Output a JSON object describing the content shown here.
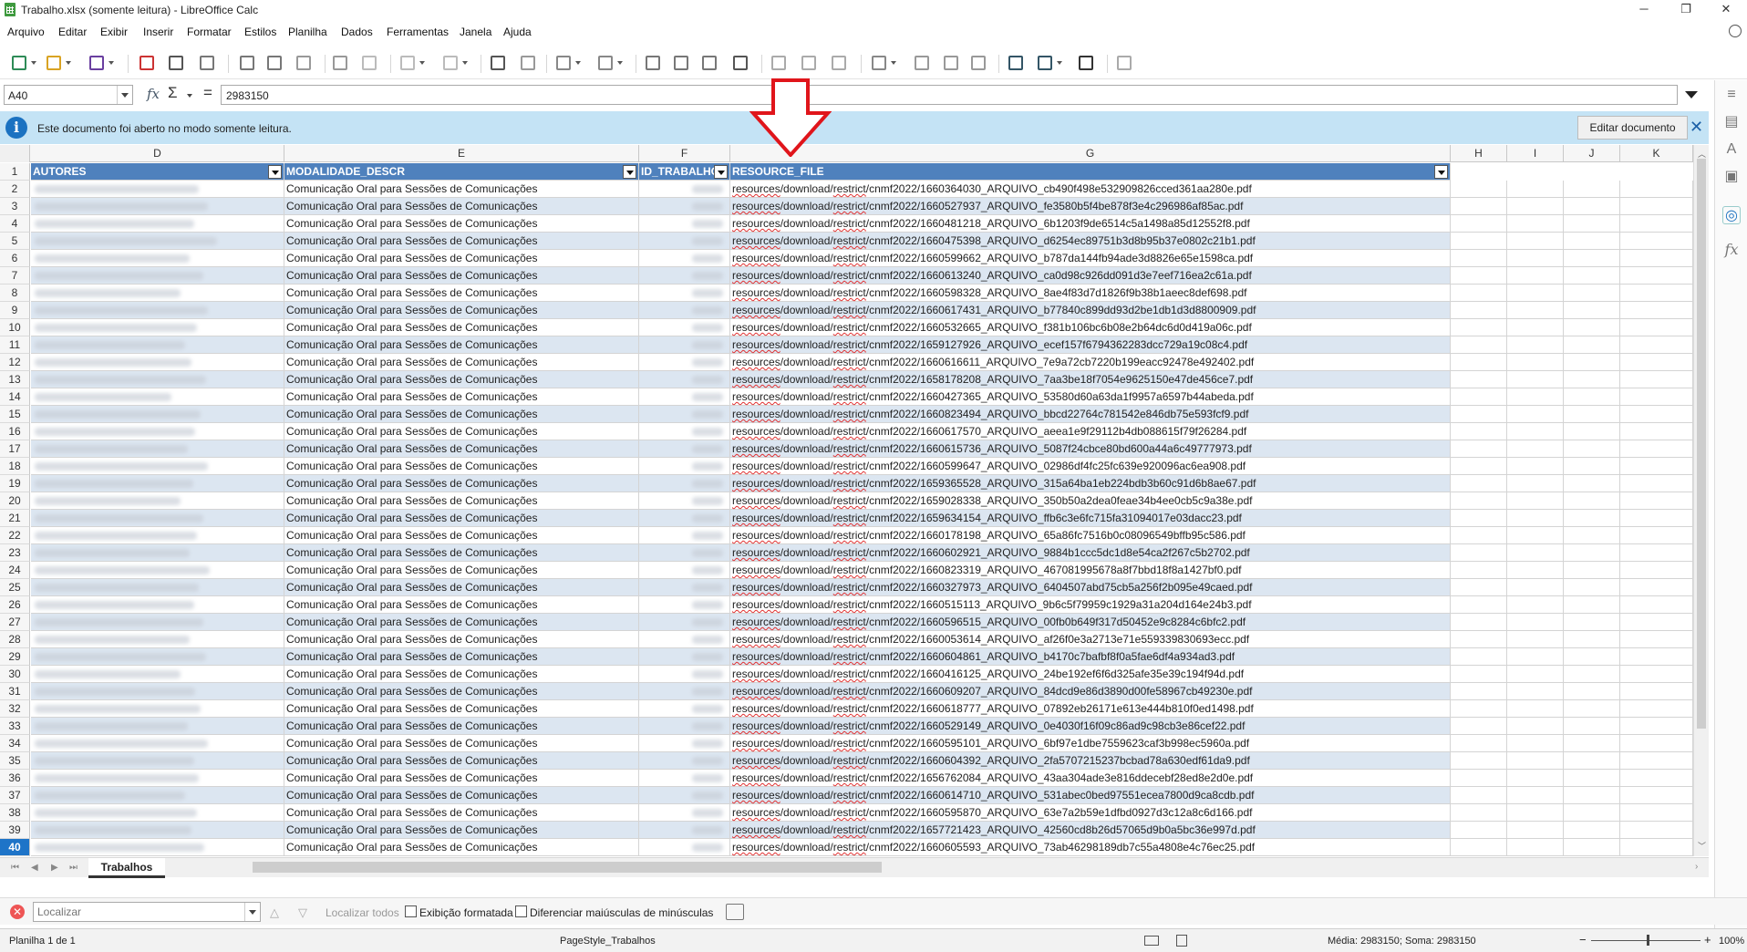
{
  "window": {
    "title": "Trabalho.xlsx (somente leitura) - LibreOffice Calc",
    "minimize": "─",
    "restore": "❐",
    "close": "✕"
  },
  "menu": [
    "Arquivo",
    "Editar",
    "Exibir",
    "Inserir",
    "Formatar",
    "Estilos",
    "Planilha",
    "Dados",
    "Ferramentas",
    "Janela",
    "Ajuda"
  ],
  "toolbar_icons": [
    "new-icon",
    "open-icon",
    "save-icon",
    "export-pdf-icon",
    "print-icon",
    "print-preview-icon",
    "cut-icon",
    "copy-icon",
    "paste-icon",
    "clone-format-icon",
    "clear-format-icon",
    "undo-icon",
    "redo-icon",
    "find-replace-icon",
    "spelling-icon",
    "row-icon",
    "column-icon",
    "sort-icon",
    "sort-ascending-icon",
    "sort-descending-icon",
    "autofilter-icon",
    "image-icon",
    "chart-icon",
    "pivot-table-icon",
    "special-character-icon",
    "hyperlink-icon",
    "comment-icon",
    "header-footer-icon",
    "define-print-area-icon",
    "freeze-rows-icon",
    "split-window-icon",
    "show-draw-functions-icon"
  ],
  "formula_bar": {
    "cell_ref": "A40",
    "fx": "fx",
    "sigma": "Σ",
    "equals": "=",
    "value": "2983150"
  },
  "infobar": {
    "message": "Este documento foi aberto no modo somente leitura.",
    "button": "Editar documento",
    "close": "✕"
  },
  "columns": [
    {
      "letter": "D"
    },
    {
      "letter": "E"
    },
    {
      "letter": "F"
    },
    {
      "letter": "G"
    },
    {
      "letter": "H"
    },
    {
      "letter": "I"
    },
    {
      "letter": "J"
    },
    {
      "letter": "K"
    }
  ],
  "headers": {
    "autores": "AUTORES",
    "modalidade": "MODALIDADE_DESCR",
    "id_trabalho": "ID_TRABALHO",
    "resource_file": "RESOURCE_FILE"
  },
  "modalidade_value": "Comunicação Oral para Sessões de Comunicações",
  "resource_prefix": "resources/download/restrict/cnmf2022/",
  "files": [
    "1660364030_ARQUIVO_cb490f498e532909826cced361aa280e.pdf",
    "1660527937_ARQUIVO_fe3580b5f4be878f3e4c296986af85ac.pdf",
    "1660481218_ARQUIVO_6b1203f9de6514c5a1498a85d12552f8.pdf",
    "1660475398_ARQUIVO_d6254ec89751b3d8b95b37e0802c21b1.pdf",
    "1660599662_ARQUIVO_b787da144fb94ade3d8826e65e1598ca.pdf",
    "1660613240_ARQUIVO_ca0d98c926dd091d3e7eef716ea2c61a.pdf",
    "1660598328_ARQUIVO_8ae4f83d7d1826f9b38b1aeec8def698.pdf",
    "1660617431_ARQUIVO_b77840c899dd93d2be1db1d3d8800909.pdf",
    "1660532665_ARQUIVO_f381b106bc6b08e2b64dc6d0d419a06c.pdf",
    "1659127926_ARQUIVO_ecef157f6794362283dcc729a19c08c4.pdf",
    "1660616611_ARQUIVO_7e9a72cb7220b199eacc92478e492402.pdf",
    "1658178208_ARQUIVO_7aa3be18f7054e9625150e47de456ce7.pdf",
    "1660427365_ARQUIVO_53580d60a63da1f9957a6597b44abeda.pdf",
    "1660823494_ARQUIVO_bbcd22764c781542e846db75e593fcf9.pdf",
    "1660617570_ARQUIVO_aeea1e9f29112b4db088615f79f26284.pdf",
    "1660615736_ARQUIVO_5087f24cbce80bd600a44a6c49777973.pdf",
    "1660599647_ARQUIVO_02986df4fc25fc639e920096ac6ea908.pdf",
    "1659365528_ARQUIVO_315a64ba1eb224bdb3b60c91d6b8ae67.pdf",
    "1659028338_ARQUIVO_350b50a2dea0feae34b4ee0cb5c9a38e.pdf",
    "1659634154_ARQUIVO_ffb6c3e6fc715fa31094017e03dacc23.pdf",
    "1660178198_ARQUIVO_65a86fc7516b0c08096549bffb95c586.pdf",
    "1660602921_ARQUIVO_9884b1ccc5dc1d8e54ca2f267c5b2702.pdf",
    "1660823319_ARQUIVO_467081995678a8f7bbd18f8a1427bf0.pdf",
    "1660327973_ARQUIVO_6404507abd75cb5a256f2b095e49caed.pdf",
    "1660515113_ARQUIVO_9b6c5f79959c1929a31a204d164e24b3.pdf",
    "1660596515_ARQUIVO_00fb0b649f317d50452e9c8284c6bfc2.pdf",
    "1660053614_ARQUIVO_af26f0e3a2713e71e559339830693ecc.pdf",
    "1660604861_ARQUIVO_b4170c7bafbf8f0a5fae6df4a934ad3.pdf",
    "1660416125_ARQUIVO_24be192ef6f6d325afe35e39c194f94d.pdf",
    "1660609207_ARQUIVO_84dcd9e86d3890d00fe58967cb49230e.pdf",
    "1660618777_ARQUIVO_07892eb26171e613e444b810f0ed1498.pdf",
    "1660529149_ARQUIVO_0e4030f16f09c86ad9c98cb3e86cef22.pdf",
    "1660595101_ARQUIVO_6bf97e1dbe7559623caf3b998ec5960a.pdf",
    "1660604392_ARQUIVO_2fa5707215237bcbad78a630edf61da9.pdf",
    "1656762084_ARQUIVO_43aa304ade3e816ddecebf28ed8e2d0e.pdf",
    "1660614710_ARQUIVO_531abec0bed97551ecea7800d9ca8cdb.pdf",
    "1660595870_ARQUIVO_63e7a2b59e1dfbd0927d3c12a8c6d166.pdf",
    "1657721423_ARQUIVO_42560cd8b26d57065d9b0a5bc36e997d.pdf",
    "1660605593_ARQUIVO_73ab46298189db7c55a4808e4c76ec25.pdf"
  ],
  "active_row": "40",
  "sheet_tab": "Trabalhos",
  "findbar": {
    "placeholder": "Localizar",
    "find_all": "Localizar todos",
    "formatted_display": "Exibição formatada",
    "match_case": "Diferenciar maiúsculas de minúsculas"
  },
  "status": {
    "sheet": "Planilha 1 de 1",
    "page_style": "PageStyle_Trabalhos",
    "summary": "Média: 2983150; Soma: 2983150",
    "zoom": "100%",
    "zoom_minus": "−",
    "zoom_plus": "+"
  },
  "colors": {
    "header_blue": "#4f81bd",
    "band_blue": "#dce6f1",
    "arrow_red": "#e0151b",
    "active_row": "#1e74c8"
  }
}
